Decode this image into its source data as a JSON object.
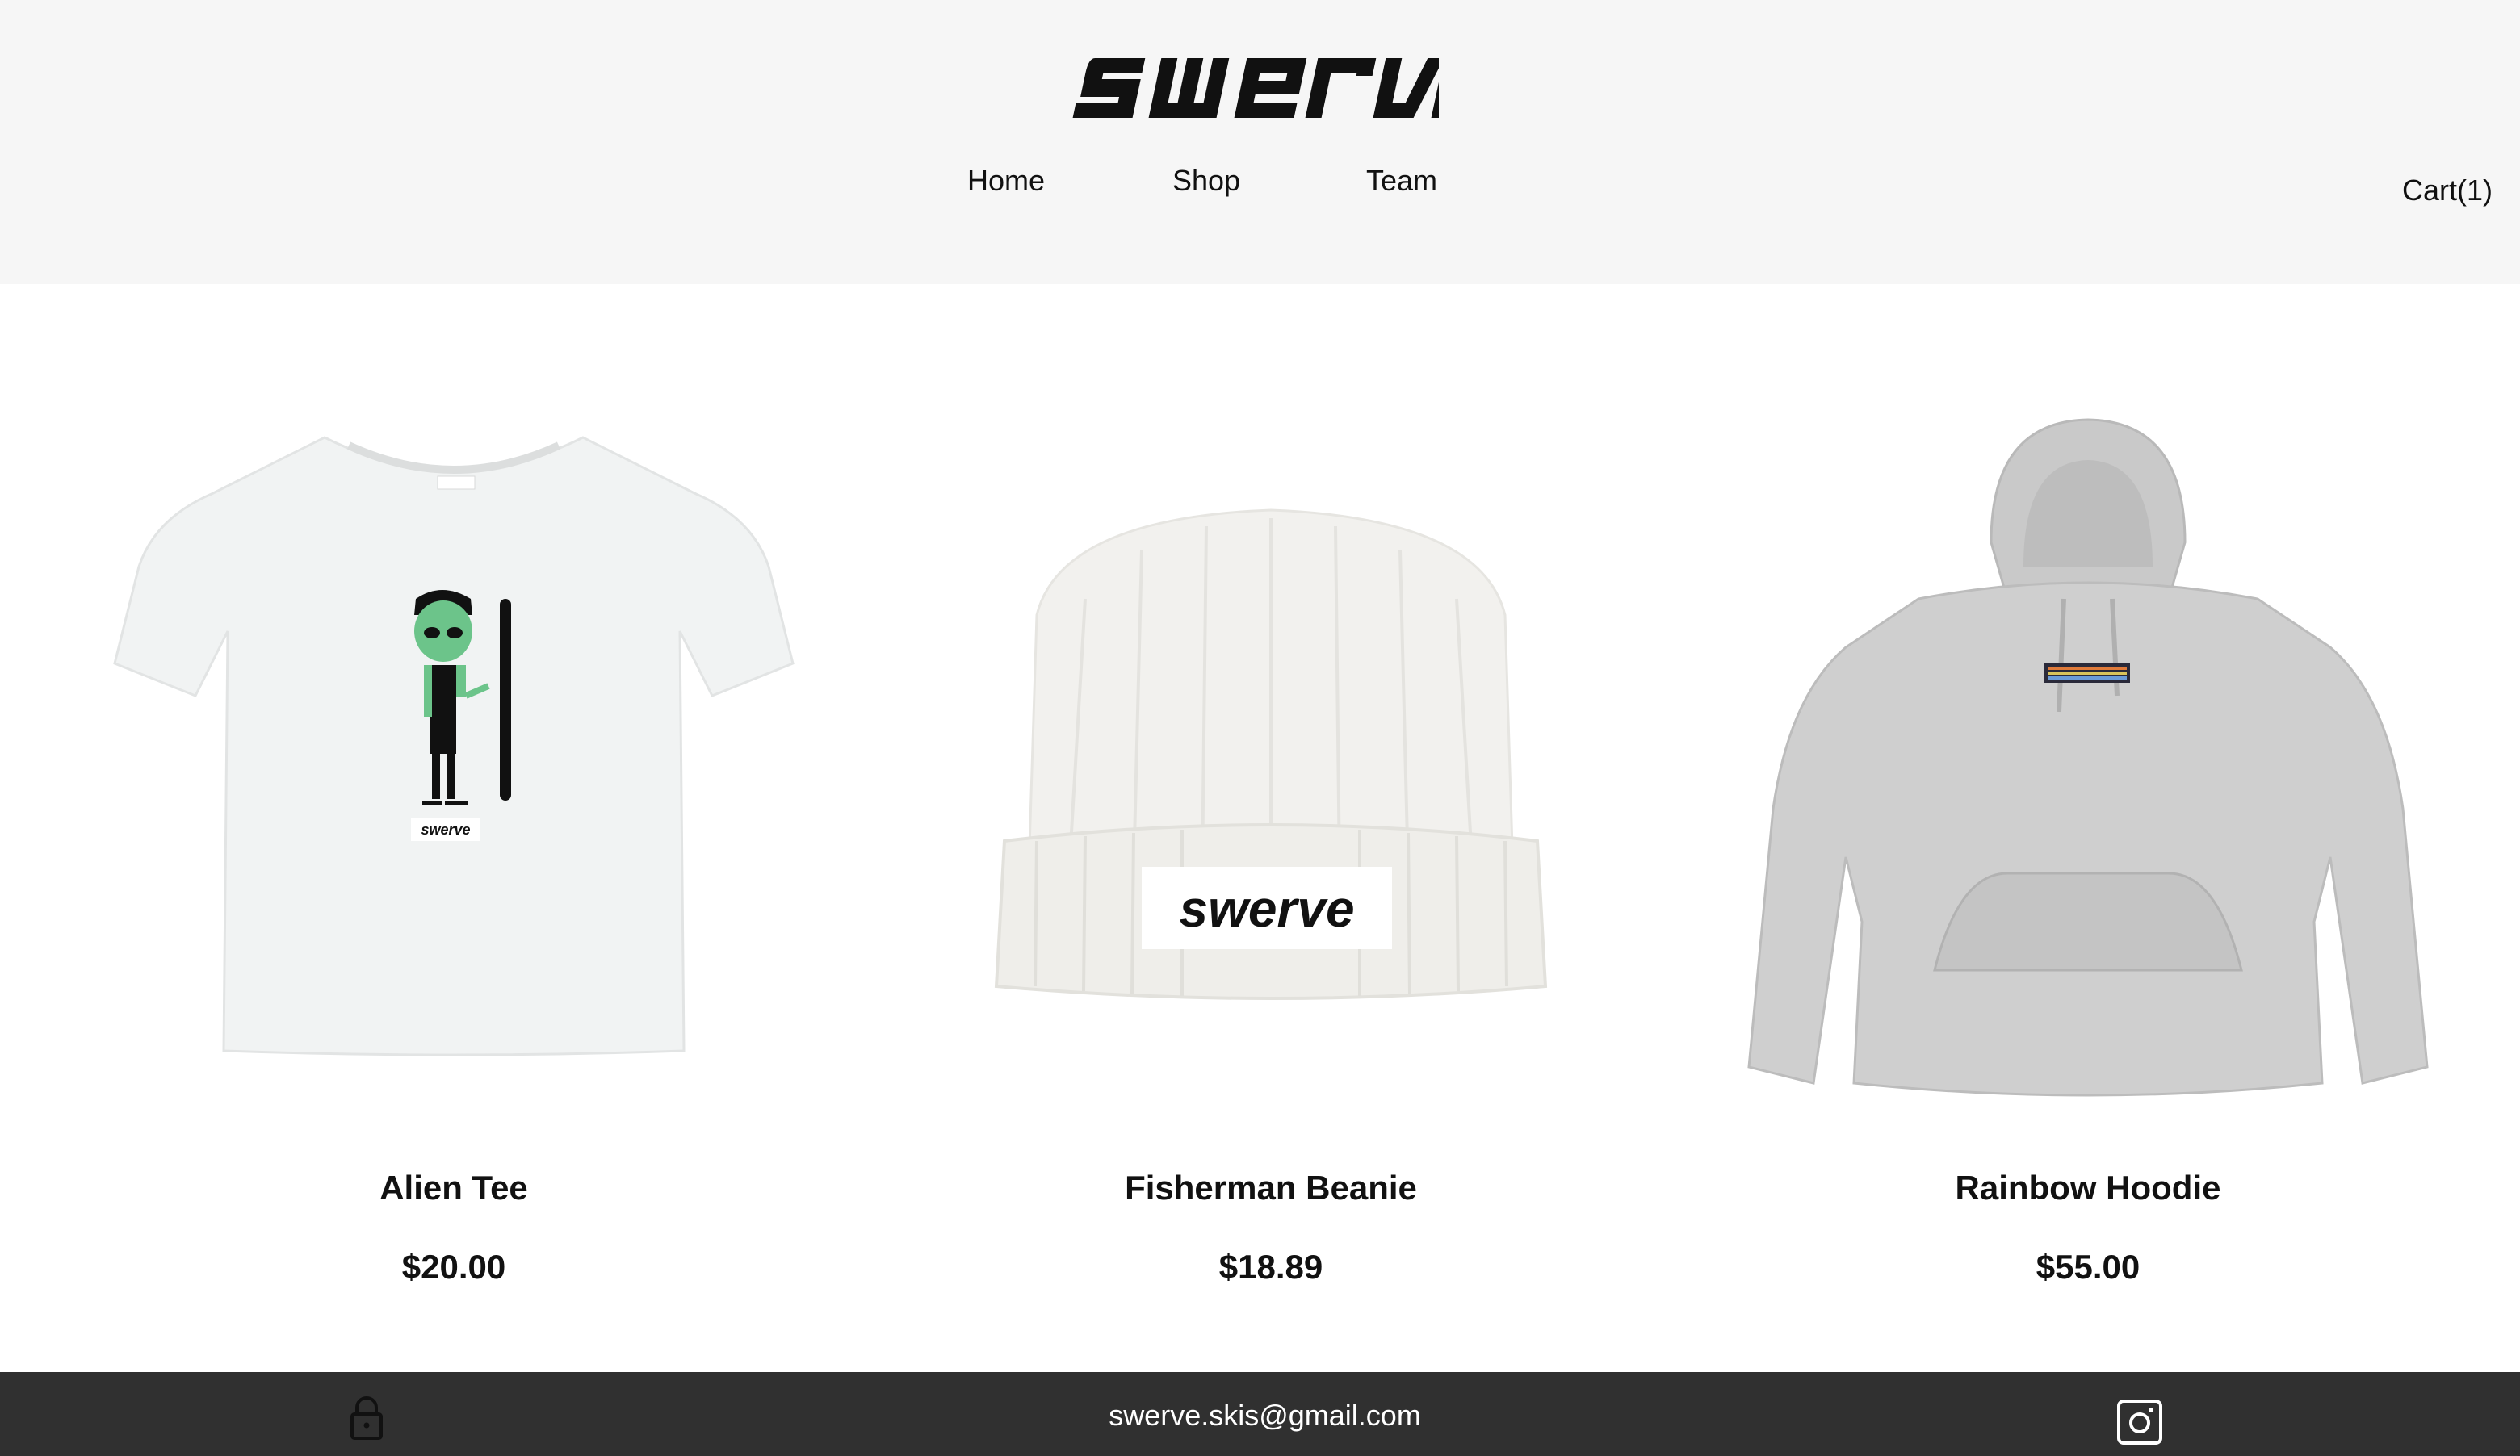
{
  "header": {
    "logo_text": "swerve",
    "nav": {
      "home": "Home",
      "shop": "Shop",
      "team": "Team"
    },
    "cart_label": "Cart(1)"
  },
  "products": [
    {
      "name": "Alien Tee",
      "price": "$20.00",
      "image": "white t-shirt with alien holding ski graphic"
    },
    {
      "name": "Fisherman Beanie",
      "price": "$18.89",
      "image": "white knit beanie with swerve patch"
    },
    {
      "name": "Rainbow Hoodie",
      "price": "$55.00",
      "image": "grey hoodie with small rainbow swerve patch"
    }
  ],
  "footer": {
    "email": "swerve.skis@gmail.com",
    "left_icon": "lock-icon",
    "right_icon": "instagram-icon"
  },
  "colors": {
    "header_bg": "#f6f6f6",
    "footer_bg": "#303030",
    "text": "#111111"
  }
}
